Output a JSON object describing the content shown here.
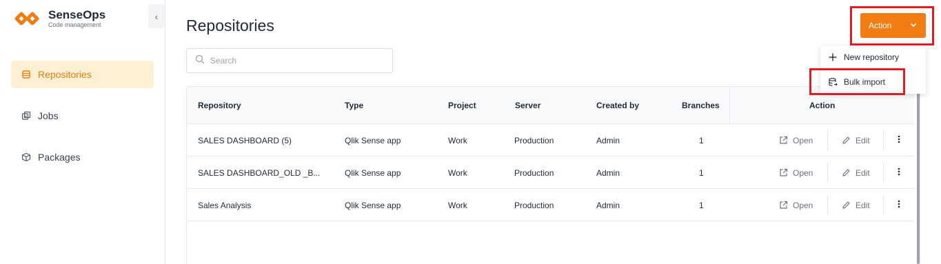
{
  "brand": {
    "name": "SenseOps",
    "subtitle": "Code management",
    "accent": "#f07c12"
  },
  "sidebar": {
    "collapse_icon": "chevron-left-icon",
    "items": [
      {
        "label": "Repositories",
        "icon": "database-icon",
        "active": true
      },
      {
        "label": "Jobs",
        "icon": "jobs-icon",
        "active": false
      },
      {
        "label": "Packages",
        "icon": "package-icon",
        "active": false
      }
    ]
  },
  "header": {
    "title": "Repositories"
  },
  "search": {
    "placeholder": "Search",
    "value": ""
  },
  "action_button": {
    "label": "Action",
    "icon": "chevron-down-icon"
  },
  "action_menu": {
    "items": [
      {
        "label": "New repository",
        "icon": "plus-icon"
      },
      {
        "label": "Bulk import",
        "icon": "database-import-icon"
      }
    ]
  },
  "table": {
    "columns": [
      "Repository",
      "Type",
      "Project",
      "Server",
      "Created by",
      "Branches",
      "Action"
    ],
    "open_label": "Open",
    "edit_label": "Edit",
    "rows": [
      {
        "repository": "SALES DASHBOARD (5)",
        "type": "Qlik Sense app",
        "project": "Work",
        "server": "Production",
        "created_by": "Admin",
        "branches": "1"
      },
      {
        "repository": "SALES DASHBOARD_OLD _B...",
        "type": "Qlik Sense app",
        "project": "Work",
        "server": "Production",
        "created_by": "Admin",
        "branches": "1"
      },
      {
        "repository": "Sales Analysis",
        "type": "Qlik Sense app",
        "project": "Work",
        "server": "Production",
        "created_by": "Admin",
        "branches": "1"
      }
    ]
  },
  "highlight_color": "#e21b23"
}
